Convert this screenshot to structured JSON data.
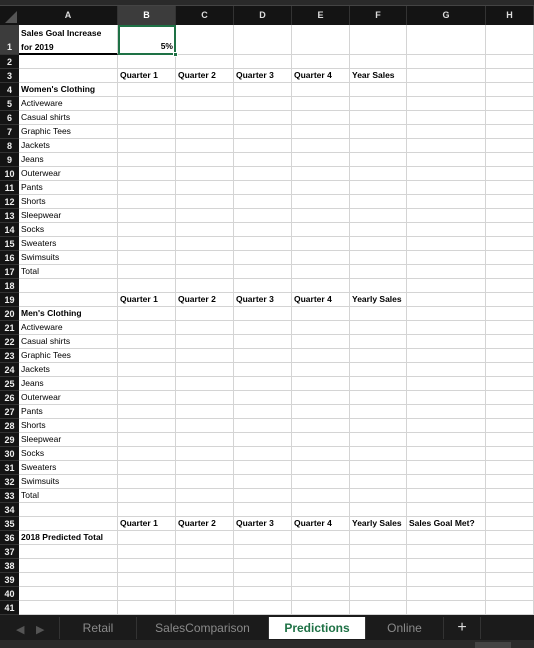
{
  "columns": [
    "A",
    "B",
    "C",
    "D",
    "E",
    "F",
    "G",
    "H"
  ],
  "selected_cell": "B1",
  "rows": {
    "1": {
      "A": "Sales Goal Increase for 2019",
      "B": "5%"
    },
    "3": {
      "B": "Quarter 1",
      "C": "Quarter 2",
      "D": "Quarter 3",
      "E": "Quarter 4",
      "F": "Year Sales"
    },
    "4": {
      "A": "Women's Clothing"
    },
    "5": {
      "A": "Activeware"
    },
    "6": {
      "A": "Casual shirts"
    },
    "7": {
      "A": "Graphic Tees"
    },
    "8": {
      "A": "Jackets"
    },
    "9": {
      "A": "Jeans"
    },
    "10": {
      "A": "Outerwear"
    },
    "11": {
      "A": "Pants"
    },
    "12": {
      "A": "Shorts"
    },
    "13": {
      "A": "Sleepwear"
    },
    "14": {
      "A": "Socks"
    },
    "15": {
      "A": "Sweaters"
    },
    "16": {
      "A": "Swimsuits"
    },
    "17": {
      "A": "Total"
    },
    "19": {
      "B": "Quarter 1",
      "C": "Quarter 2",
      "D": "Quarter 3",
      "E": "Quarter 4",
      "F": "Yearly Sales"
    },
    "20": {
      "A": "Men's Clothing"
    },
    "21": {
      "A": "Activeware"
    },
    "22": {
      "A": "Casual shirts"
    },
    "23": {
      "A": "Graphic Tees"
    },
    "24": {
      "A": "Jackets"
    },
    "25": {
      "A": "Jeans"
    },
    "26": {
      "A": "Outerwear"
    },
    "27": {
      "A": "Pants"
    },
    "28": {
      "A": "Shorts"
    },
    "29": {
      "A": "Sleepwear"
    },
    "30": {
      "A": "Socks"
    },
    "31": {
      "A": "Sweaters"
    },
    "32": {
      "A": "Swimsuits"
    },
    "33": {
      "A": "Total"
    },
    "35": {
      "B": "Quarter 1",
      "C": "Quarter 2",
      "D": "Quarter 3",
      "E": "Quarter 4",
      "F": "Yearly Sales",
      "G": "Sales Goal Met?"
    },
    "36": {
      "A": "2018 Predicted Total"
    }
  },
  "bold_rows": [
    "1",
    "3",
    "4",
    "19",
    "20",
    "35",
    "36"
  ],
  "row_count": 41,
  "sheet_tabs": [
    {
      "label": "Retail",
      "active": false
    },
    {
      "label": "SalesComparison",
      "active": false
    },
    {
      "label": "Predictions",
      "active": true
    },
    {
      "label": "Online",
      "active": false
    }
  ],
  "add_sheet_label": "+",
  "accent_color": "#1e7145"
}
